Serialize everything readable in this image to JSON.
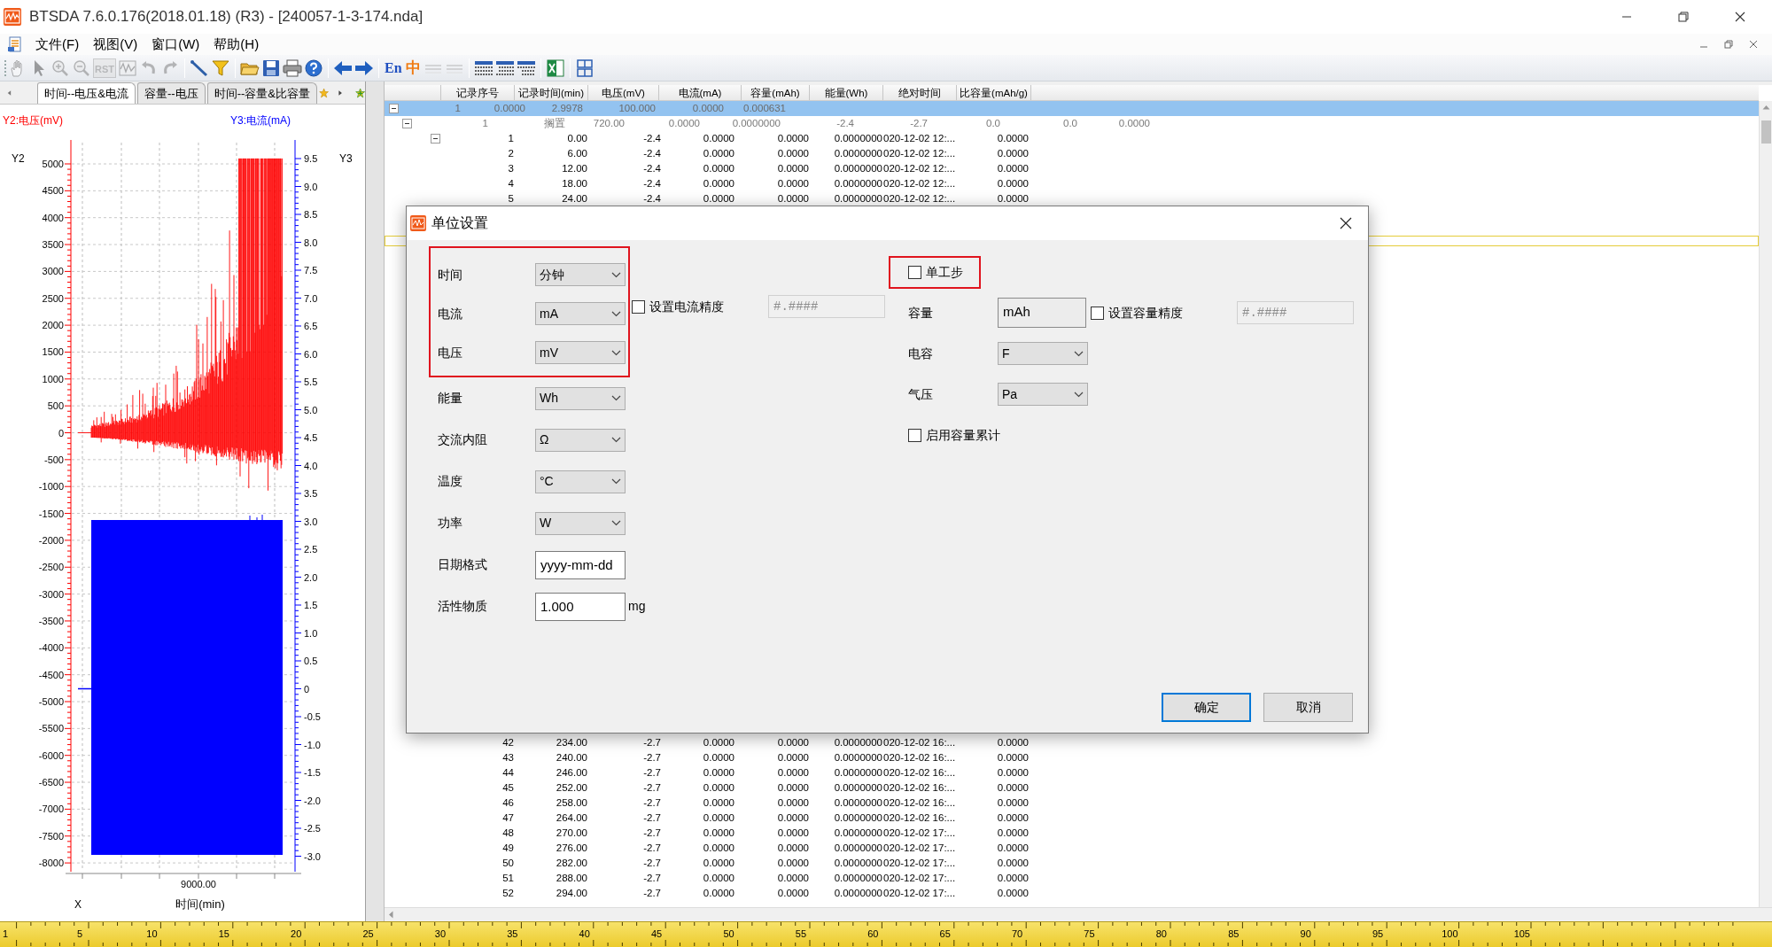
{
  "window": {
    "title": "BTSDA 7.6.0.176(2018.01.18) (R3) - [240057-1-3-174.nda]"
  },
  "menu": [
    "文件(F)",
    "视图(V)",
    "窗口(W)",
    "帮助(H)"
  ],
  "toolbar_groups": [
    [
      {
        "disabled": true
      },
      {
        "disabled": true
      },
      {
        "disabled": true
      },
      {
        "disabled": true
      },
      {
        "label": "RST",
        "disabled": true
      },
      {
        "disabled": true
      },
      {
        "disabled": true
      },
      {
        "disabled": true
      }
    ],
    [
      {
        "disabled": false
      },
      {
        "disabled": false
      }
    ],
    [
      {
        "disabled": false
      },
      {
        "disabled": false
      },
      {
        "disabled": false
      },
      {
        "disabled": false
      }
    ],
    [
      {
        "disabled": false
      },
      {
        "disabled": false
      }
    ],
    [
      {
        "label": "En",
        "disabled": false
      },
      {
        "label": "中",
        "disabled": false
      },
      {
        "disabled": true
      },
      {
        "disabled": true
      }
    ],
    [
      {
        "disabled": false
      },
      {
        "disabled": false
      },
      {
        "disabled": false
      }
    ],
    [
      {
        "disabled": false
      }
    ],
    [
      {
        "disabled": false
      }
    ]
  ],
  "chart_tabs": [
    {
      "label": "时间--电压&电流",
      "selected": true
    },
    {
      "label": "容量--电压",
      "selected": false
    },
    {
      "label": "时间--容量&比容量",
      "selected": false
    }
  ],
  "chart": {
    "y2_title": "Y2:电压(mV)",
    "y3_title": "Y3:电流(mA)",
    "y2_name": "Y2",
    "y3_name": "Y3",
    "x_name": "X",
    "x_title": "时间(min)",
    "y2_ticks": [
      "5000",
      "4500",
      "4000",
      "3500",
      "3000",
      "2500",
      "2000",
      "1500",
      "1000",
      "500",
      "0",
      "-500",
      "-1000",
      "-1500",
      "-2000",
      "-2500",
      "-3000",
      "-3500",
      "-4000",
      "-4500",
      "-5000",
      "-5500",
      "-6000",
      "-6500",
      "-7000",
      "-7500",
      "-8000"
    ],
    "y3_ticks": [
      "9.5",
      "9.0",
      "8.5",
      "8.0",
      "7.5",
      "7.0",
      "6.5",
      "6.0",
      "5.5",
      "5.0",
      "4.5",
      "4.0",
      "3.5",
      "3.0",
      "2.5",
      "2.0",
      "1.5",
      "1.0",
      "0.5",
      "0",
      "-0.5",
      "-1.0",
      "-1.5",
      "-2.0",
      "-2.5",
      "-3.0"
    ],
    "x_ticks": [
      "9000.00"
    ]
  },
  "table": {
    "columns": [
      "记录序号",
      "记录时间(min)",
      "电压(mV)",
      "电流(mA)",
      "容量(mAh)",
      "能量(Wh)",
      "绝对时间",
      "比容量(mAh/g)"
    ],
    "group_rows": [
      {
        "kind": "cycle",
        "expanded": true,
        "selected": true,
        "values": [
          "1",
          "0.0000",
          "2.9978",
          "100.000",
          "0.0000",
          "0.000631"
        ]
      },
      {
        "kind": "step",
        "expanded": true,
        "selected": false,
        "values": [
          "1",
          "搁置",
          "720.00",
          "0.0000",
          "0.0000000",
          "-2.4",
          "-2.7",
          "0.0",
          "0.0",
          "0.0000"
        ]
      }
    ],
    "rows": [
      {
        "kind": "record",
        "expanded": true,
        "selected": false,
        "cells": [
          "1",
          "0.00",
          "-2.4",
          "0.0000",
          "0.0000",
          "0.0000000",
          "020-12-02 12:...",
          "0.0000"
        ]
      },
      {
        "kind": "record",
        "selected": false,
        "cells": [
          "2",
          "6.00",
          "-2.4",
          "0.0000",
          "0.0000",
          "0.0000000",
          "020-12-02 12:...",
          "0.0000"
        ]
      },
      {
        "kind": "record",
        "selected": false,
        "cells": [
          "3",
          "12.00",
          "-2.4",
          "0.0000",
          "0.0000",
          "0.0000000",
          "020-12-02 12:...",
          "0.0000"
        ]
      },
      {
        "kind": "record",
        "selected": false,
        "cells": [
          "4",
          "18.00",
          "-2.4",
          "0.0000",
          "0.0000",
          "0.0000000",
          "020-12-02 12:...",
          "0.0000"
        ]
      },
      {
        "kind": "record",
        "selected": false,
        "cells": [
          "5",
          "24.00",
          "-2.4",
          "0.0000",
          "0.0000",
          "0.0000000",
          "020-12-02 12:...",
          "0.0000"
        ]
      }
    ],
    "focus_outline": true,
    "rows_below_dialog": [
      {
        "kind": "record",
        "selected": false,
        "cells": [
          "42",
          "234.00",
          "-2.7",
          "0.0000",
          "0.0000",
          "0.0000000",
          "020-12-02 16:...",
          "0.0000"
        ]
      },
      {
        "kind": "record",
        "selected": false,
        "cells": [
          "43",
          "240.00",
          "-2.7",
          "0.0000",
          "0.0000",
          "0.0000000",
          "020-12-02 16:...",
          "0.0000"
        ]
      },
      {
        "kind": "record",
        "selected": false,
        "cells": [
          "44",
          "246.00",
          "-2.7",
          "0.0000",
          "0.0000",
          "0.0000000",
          "020-12-02 16:...",
          "0.0000"
        ]
      },
      {
        "kind": "record",
        "selected": false,
        "cells": [
          "45",
          "252.00",
          "-2.7",
          "0.0000",
          "0.0000",
          "0.0000000",
          "020-12-02 16:...",
          "0.0000"
        ]
      },
      {
        "kind": "record",
        "selected": false,
        "cells": [
          "46",
          "258.00",
          "-2.7",
          "0.0000",
          "0.0000",
          "0.0000000",
          "020-12-02 16:...",
          "0.0000"
        ]
      },
      {
        "kind": "record",
        "selected": false,
        "cells": [
          "47",
          "264.00",
          "-2.7",
          "0.0000",
          "0.0000",
          "0.0000000",
          "020-12-02 16:...",
          "0.0000"
        ]
      },
      {
        "kind": "record",
        "selected": false,
        "cells": [
          "48",
          "270.00",
          "-2.7",
          "0.0000",
          "0.0000",
          "0.0000000",
          "020-12-02 17:...",
          "0.0000"
        ]
      },
      {
        "kind": "record",
        "selected": false,
        "cells": [
          "49",
          "276.00",
          "-2.7",
          "0.0000",
          "0.0000",
          "0.0000000",
          "020-12-02 17:...",
          "0.0000"
        ]
      },
      {
        "kind": "record",
        "selected": false,
        "cells": [
          "50",
          "282.00",
          "-2.7",
          "0.0000",
          "0.0000",
          "0.0000000",
          "020-12-02 17:...",
          "0.0000"
        ]
      },
      {
        "kind": "record",
        "selected": false,
        "cells": [
          "51",
          "288.00",
          "-2.7",
          "0.0000",
          "0.0000",
          "0.0000000",
          "020-12-02 17:...",
          "0.0000"
        ]
      },
      {
        "kind": "record",
        "selected": false,
        "cells": [
          "52",
          "294.00",
          "-2.7",
          "0.0000",
          "0.0000",
          "0.0000000",
          "020-12-02 17:...",
          "0.0000"
        ]
      }
    ]
  },
  "dialog": {
    "title": "单位设置",
    "left_fields": [
      {
        "label": "时间",
        "kind": "select",
        "value": "分钟",
        "highlighted": true
      },
      {
        "label": "电流",
        "kind": "select",
        "value": "mA",
        "highlighted": true,
        "precision": {
          "label": "设置电流精度",
          "checked": false,
          "value": "#.####",
          "disabled": true
        }
      },
      {
        "label": "电压",
        "kind": "select",
        "value": "mV",
        "highlighted": true
      },
      {
        "label": "能量",
        "kind": "select",
        "value": "Wh",
        "highlighted": false
      },
      {
        "label": "交流内阻",
        "kind": "select",
        "value": "Ω",
        "highlighted": false
      },
      {
        "label": "温度",
        "kind": "select",
        "value": "°C",
        "highlighted": false
      },
      {
        "label": "功率",
        "kind": "select",
        "value": "W",
        "highlighted": false
      },
      {
        "label": "日期格式",
        "kind": "input",
        "value": "yyyy-mm-dd",
        "highlighted": false
      },
      {
        "label": "活性物质",
        "kind": "input",
        "value": "1.000",
        "unit": "mg",
        "highlighted": false
      }
    ],
    "right_fields": [
      {
        "label": "单工步",
        "kind": "checkbox",
        "checked": false,
        "highlighted": true
      },
      {
        "label": "容量",
        "kind": "readonly",
        "value": "mAh",
        "precision": {
          "label": "设置容量精度",
          "checked": false,
          "value": "#.####",
          "disabled": true
        }
      },
      {
        "label": "电容",
        "kind": "select",
        "value": "F"
      },
      {
        "label": "气压",
        "kind": "select",
        "value": "Pa"
      },
      {
        "label": "启用容量累计",
        "kind": "checkbox",
        "checked": false,
        "highlighted": false
      }
    ],
    "buttons": [
      {
        "label": "确定",
        "default": true
      },
      {
        "label": "取消",
        "default": false
      }
    ]
  },
  "ruler": {
    "labels": [
      "1",
      "5",
      "10",
      "15",
      "20",
      "25",
      "30",
      "35",
      "40",
      "45",
      "50",
      "55",
      "60",
      "65",
      "70",
      "75",
      "80",
      "85",
      "90",
      "95",
      "100",
      "105"
    ]
  }
}
